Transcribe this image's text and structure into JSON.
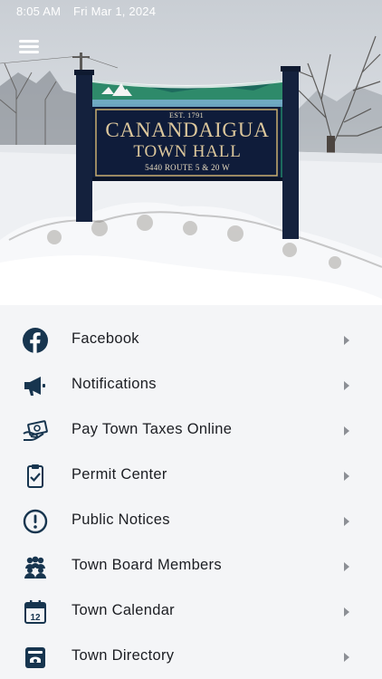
{
  "status_bar": {
    "time": "8:05 AM",
    "date": "Fri Mar 1, 2024"
  },
  "hero": {
    "sign_est": "EST. 1791",
    "sign_line1": "CANANDAIGUA",
    "sign_line2": "TOWN HALL",
    "sign_address": "5440 ROUTE 5 & 20 W"
  },
  "menu": {
    "items": [
      {
        "label": "Facebook",
        "icon": "facebook-icon"
      },
      {
        "label": "Notifications",
        "icon": "megaphone-icon"
      },
      {
        "label": "Pay Town Taxes Online",
        "icon": "money-hand-icon"
      },
      {
        "label": "Permit Center",
        "icon": "clipboard-check-icon"
      },
      {
        "label": "Public Notices",
        "icon": "exclamation-circle-icon"
      },
      {
        "label": "Town Board Members",
        "icon": "people-group-icon"
      },
      {
        "label": "Town Calendar",
        "icon": "calendar-icon"
      },
      {
        "label": "Town Directory",
        "icon": "phone-directory-icon"
      }
    ]
  },
  "colors": {
    "icon": "#17354f",
    "chevron": "#8c8f95",
    "background": "#f4f5f7"
  }
}
